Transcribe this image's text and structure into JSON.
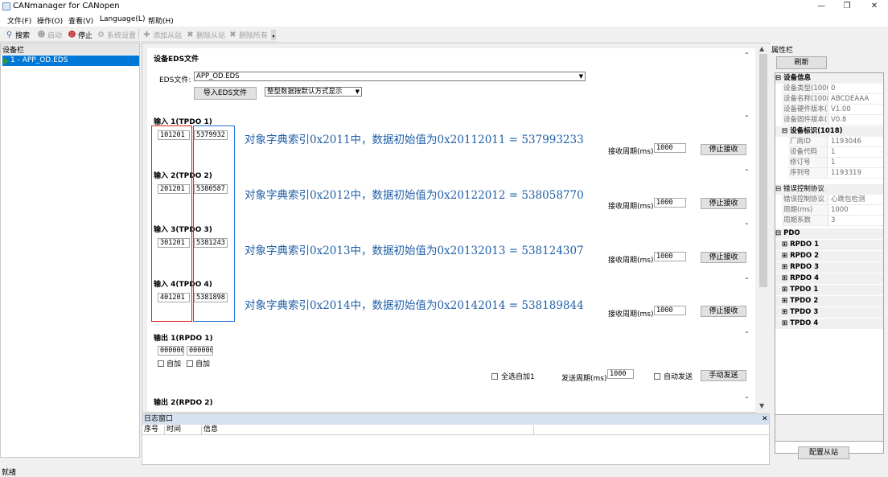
{
  "window": {
    "title": "CANmanager for CANopen",
    "minimize": "—",
    "maximize": "❐",
    "close": "✕"
  },
  "menu": [
    "文件(F)",
    "操作(O)",
    "查看(V)",
    "Language(L)",
    "帮助(H)"
  ],
  "toolbar": {
    "search": "搜索",
    "start": "启动",
    "stop": "停止",
    "settings": "系统设置",
    "add_slave": "添加从站",
    "del_slave": "删除从站",
    "del_all": "删除所有"
  },
  "device_panel": {
    "header": "设备栏",
    "item": "1 - APP_OD.EDS"
  },
  "eds": {
    "section_title": "设备EDS文件",
    "file_label": "EDS文件:",
    "file_value": "APP_OD.EDS",
    "import_button": "导入EDS文件",
    "display_mode": "整型数据按默认方式显示"
  },
  "inputs": [
    {
      "title": "输入 1(TPDO 1)",
      "index": "101201",
      "value": "5379932",
      "period_label": "接收周期(ms)",
      "period": "1000",
      "button": "停止接收",
      "note": "对象字典索引0x2011中，数据初始值为0x20112011 = 537993233"
    },
    {
      "title": "输入 2(TPDO 2)",
      "index": "201201",
      "value": "5380587",
      "period_label": "接收周期(ms)",
      "period": "1000",
      "button": "停止接收",
      "note": "对象字典索引0x2012中，数据初始值为0x20122012 = 538058770"
    },
    {
      "title": "输入 3(TPDO 3)",
      "index": "301201",
      "value": "5381243",
      "period_label": "接收周期(ms)",
      "period": "1000",
      "button": "停止接收",
      "note": "对象字典索引0x2013中，数据初始值为0x20132013 = 538124307"
    },
    {
      "title": "输入 4(TPDO 4)",
      "index": "401201",
      "value": "5381898",
      "period_label": "接收周期(ms)",
      "period": "1000",
      "button": "停止接收",
      "note": "对象字典索引0x2014中，数据初始值为0x20142014 = 538189844"
    }
  ],
  "output1": {
    "title": "输出 1(RPDO 1)",
    "field1": "000000",
    "field2": "000000",
    "auto1": "自加",
    "auto2": "自加",
    "select_all": "全选自加1",
    "send_period_label": "发送周期(ms)",
    "send_period": "1000",
    "auto_send": "自动发送",
    "manual_send": "手动发送"
  },
  "output2": {
    "title": "输出 2(RPDO 2)"
  },
  "log": {
    "title": "日志窗口",
    "columns": [
      "序号",
      "时间",
      "信息"
    ]
  },
  "status": "就绪",
  "properties": {
    "header": "属性栏",
    "refresh": "刷新",
    "device_info": "设备信息",
    "rows": [
      {
        "name": "设备类型(1000",
        "value": "0"
      },
      {
        "name": "设备名称(1008",
        "value": "ABCDEAAA"
      },
      {
        "name": "设备硬件版本(1",
        "value": "V1.00"
      },
      {
        "name": "设备固件版本(1",
        "value": "V0.8"
      }
    ],
    "identity": "设备标识(1018)",
    "identity_rows": [
      {
        "name": "厂商ID",
        "value": "1193046"
      },
      {
        "name": "设备代码",
        "value": "1"
      },
      {
        "name": "修订号",
        "value": "1"
      },
      {
        "name": "序列号",
        "value": "1193319"
      }
    ],
    "error_ctrl": "错误控制协议",
    "error_rows": [
      {
        "name": "错误控制协议",
        "value": "心跳包检测"
      },
      {
        "name": "周期(ms)",
        "value": "1000"
      },
      {
        "name": "周期系数",
        "value": "3"
      }
    ],
    "pdo": "PDO",
    "pdo_items": [
      "RPDO 1",
      "RPDO 2",
      "RPDO 3",
      "RPDO 4",
      "TPDO 1",
      "TPDO 2",
      "TPDO 3",
      "TPDO 4"
    ],
    "config_slave": "配置从站"
  },
  "icons": {
    "expanded": "⊟",
    "collapsed": "⊞",
    "collapse_up": "⌃"
  }
}
